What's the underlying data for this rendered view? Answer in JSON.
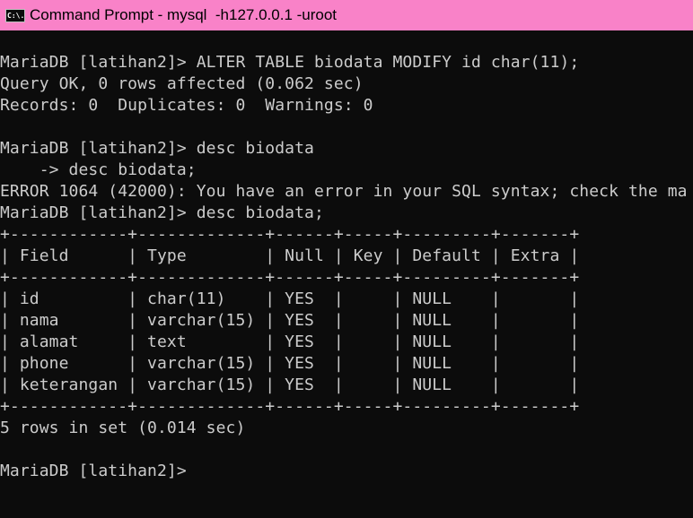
{
  "window": {
    "title": "Command Prompt - mysql  -h127.0.0.1 -uroot",
    "icon": {
      "name": "command-prompt-icon",
      "glyph": "C:\\."
    },
    "colors": {
      "titlebar": "#f982c8",
      "console_bg": "#0c0c0c",
      "console_text": "#cccccc"
    }
  },
  "console": {
    "lines": [
      "MariaDB [latihan2]> ALTER TABLE biodata MODIFY id char(11);",
      "Query OK, 0 rows affected (0.062 sec)",
      "Records: 0  Duplicates: 0  Warnings: 0",
      "",
      "MariaDB [latihan2]> desc biodata",
      "    -> desc biodata;",
      "ERROR 1064 (42000): You have an error in your SQL syntax; check the ma",
      "MariaDB [latihan2]> desc biodata;",
      "+------------+-------------+------+-----+---------+-------+",
      "| Field      | Type        | Null | Key | Default | Extra |",
      "+------------+-------------+------+-----+---------+-------+",
      "| id         | char(11)    | YES  |     | NULL    |       |",
      "| nama       | varchar(15) | YES  |     | NULL    |       |",
      "| alamat     | text        | YES  |     | NULL    |       |",
      "| phone      | varchar(15) | YES  |     | NULL    |       |",
      "| keterangan | varchar(15) | YES  |     | NULL    |       |",
      "+------------+-------------+------+-----+---------+-------+",
      "5 rows in set (0.014 sec)",
      "",
      "MariaDB [latihan2]>"
    ]
  }
}
